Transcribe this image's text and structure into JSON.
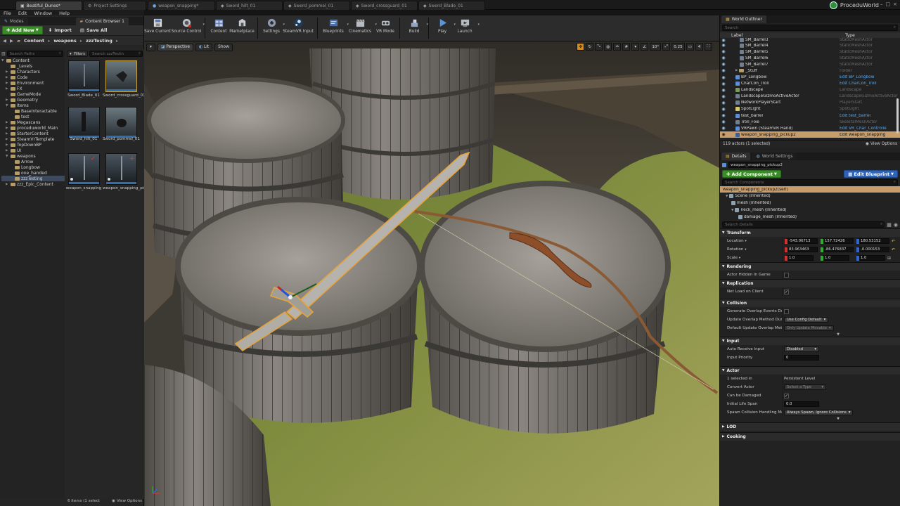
{
  "tabs": [
    {
      "label": "Beatiful_Dunes*"
    },
    {
      "label": "Project Settings"
    },
    {
      "label": "weapon_snapping*"
    },
    {
      "label": "Sword_hilt_01"
    },
    {
      "label": "Sword_pommel_01"
    },
    {
      "label": "Sword_crossguard_01"
    },
    {
      "label": "Sword_Blade_01"
    }
  ],
  "brand": "ProceduWorld",
  "menu": {
    "file": "File",
    "edit": "Edit",
    "window": "Window",
    "help": "Help"
  },
  "toolbar": [
    {
      "label": "Save Current"
    },
    {
      "label": "Source Control"
    },
    {
      "label": "Content"
    },
    {
      "label": "Marketplace"
    },
    {
      "label": "Settings"
    },
    {
      "label": "SteamVR Input"
    },
    {
      "label": "Blueprints"
    },
    {
      "label": "Cinematics"
    },
    {
      "label": "VR Mode"
    },
    {
      "label": "Build"
    },
    {
      "label": "Play"
    },
    {
      "label": "Launch"
    }
  ],
  "left": {
    "tab_modes": "Modes",
    "tab_cb": "Content Browser 1",
    "add_new": "Add New",
    "import": "Import",
    "save_all": "Save All",
    "path": [
      "Content",
      "weapons",
      "zzzTesting"
    ],
    "search_paths": "Search Paths",
    "filters": "Filters",
    "search_assets": "Search zzzTestin",
    "tree": [
      "Content",
      "_Levels",
      "Characters",
      "Code",
      "Environment",
      "FX",
      "GameMode",
      "Geometry",
      "Items",
      "BaseInteractable",
      "test",
      "Megascans",
      "proceduworld_Main",
      "StarterContent",
      "SteamVrTemplate",
      "TopDownBP",
      "UI",
      "weapons",
      "Arrow",
      "Longbow",
      "one_handed",
      "zzzTesting",
      "zzz_Epic_Content"
    ],
    "assets": [
      {
        "label": "Sword_Blade_01"
      },
      {
        "label": "Sword_crossguard_01"
      },
      {
        "label": "Sword_hilt_01"
      },
      {
        "label": "Sword_pommel_01"
      },
      {
        "label": "weapon_snapping"
      },
      {
        "label": "weapon_snapping_pickup"
      }
    ],
    "status": "6 items (1 select",
    "view_options": "View Options"
  },
  "viewport": {
    "perspective": "Perspective",
    "lit": "Lit",
    "show": "Show",
    "angle": "10°",
    "scale": "0.25",
    "camera_speed": "4"
  },
  "outliner": {
    "tab": "World Outliner",
    "search": "Search",
    "col_label": "Label",
    "col_type": "Type",
    "rows": [
      {
        "label": "SM_Barrel3",
        "type": "StaticMeshActor"
      },
      {
        "label": "SM_Barrel4",
        "type": "StaticMeshActor"
      },
      {
        "label": "SM_Barrel5",
        "type": "StaticMeshActor"
      },
      {
        "label": "SM_Barrel6",
        "type": "StaticMeshActor"
      },
      {
        "label": "SM_Barrel7",
        "type": "StaticMeshActor"
      },
      {
        "label": "_Stuff",
        "type": "Folder"
      },
      {
        "label": "BP_Longbow",
        "type": "Edit BP_Longbow"
      },
      {
        "label": "CharCon_Troll",
        "type": "Edit CharCon_Troll"
      },
      {
        "label": "Landscape",
        "type": "Landscape"
      },
      {
        "label": "LandscapeGizmoActiveActor",
        "type": "LandscapeGizmoActiveActor"
      },
      {
        "label": "NetworkPlayerStart",
        "type": "PlayerStart"
      },
      {
        "label": "SpotLight",
        "type": "SpotLight"
      },
      {
        "label": "test_barrel",
        "type": "Edit test_barrel"
      },
      {
        "label": "Troll_Fixe",
        "type": "SkeletalMeshActor"
      },
      {
        "label": "VRPawn (SteamVR Hand)",
        "type": "Edit VR_Char_Controlle"
      },
      {
        "label": "weapon_snapping_pickup2",
        "type": "Edit weapon_snapping"
      }
    ],
    "status": "119 actors (1 selected)",
    "view_options": "View Options"
  },
  "details": {
    "tab": "Details",
    "tab_world": "World Settings",
    "actor_name": "weapon_snapping_pickup2",
    "add_component": "Add Component",
    "edit_blueprint": "Edit Blueprint",
    "search_components": "Search Components",
    "components": [
      "weapon_snapping_pickup2(self)",
      "Scene (Inherited)",
      "mesh (Inherited)",
      "neck_mesh (Inherited)",
      "damage_mesh (Inherited)"
    ],
    "search_details": "Search Details",
    "transform": "Transform",
    "location": {
      "label": "Location",
      "x": "-543.06713",
      "y": "157.72426",
      "z": "180.53152"
    },
    "rotation": {
      "label": "Rotation",
      "x": "83.963463",
      "y": "-86.476837",
      "z": "-0.000153"
    },
    "scale": {
      "label": "Scale",
      "x": "1.0",
      "y": "1.0",
      "z": "1.0"
    },
    "rendering": "Rendering",
    "actor_hidden": "Actor Hidden In Game",
    "replication": "Replication",
    "net_load": "Net Load on Client",
    "collision": "Collision",
    "gen_overlap": "Generate Overlap Events During",
    "update_overlap": "Update Overlap Method During",
    "update_overlap_val": "Use Config Default",
    "default_update": "Default Update Overlap Metho",
    "default_update_val": "Only Update Movable",
    "input": "Input",
    "auto_receive": "Auto Receive Input",
    "auto_receive_val": "Disabled",
    "input_priority": "Input Priority",
    "input_priority_val": "0",
    "actor": "Actor",
    "selected_in": "1 selected in",
    "persistent": "Persistent Level",
    "convert_actor": "Convert Actor",
    "select_type": "Select a Type",
    "can_be_damaged": "Can be Damaged",
    "initial_life": "Initial Life Span",
    "initial_life_val": "0.0",
    "spawn_collision": "Spawn Collision Handling Meth",
    "spawn_collision_val": "Always Spawn, Ignore Collisions",
    "lod": "LOD",
    "cooking": "Cooking"
  }
}
